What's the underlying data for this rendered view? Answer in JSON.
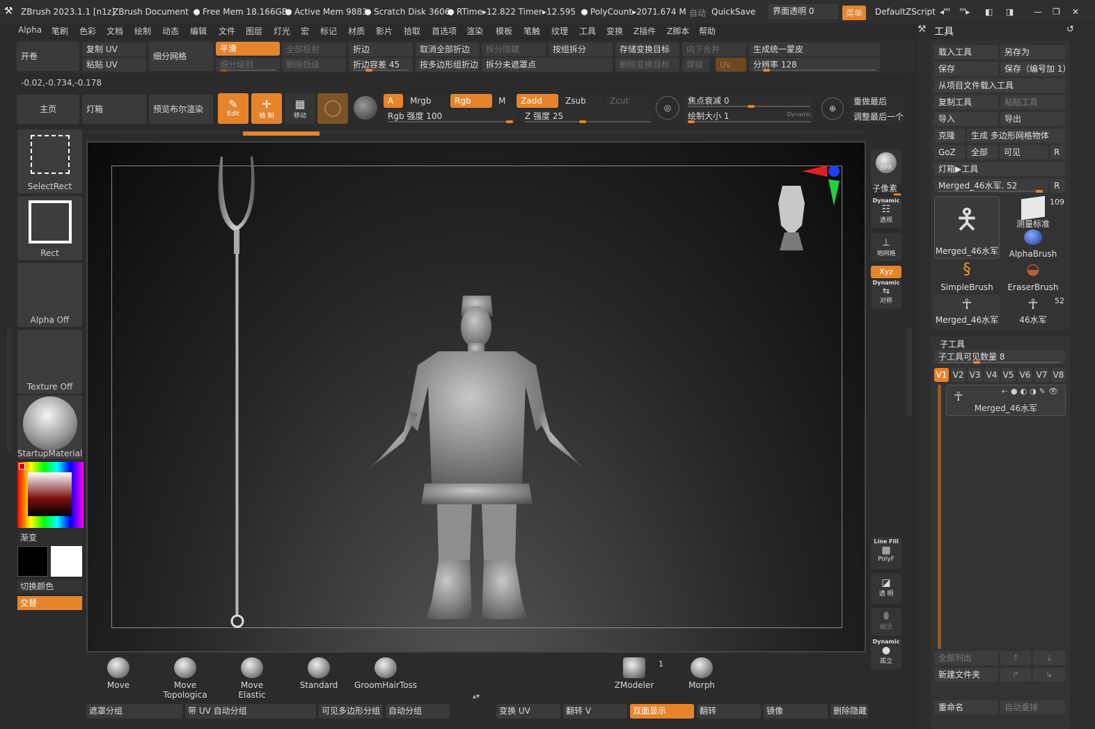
{
  "titlebar": {
    "app": "ZBrush 2023.1.1 [n1z]",
    "doc": "ZBrush Document",
    "free_mem": "Free Mem 18.166GB",
    "active_mem": "Active Mem 9883",
    "scratch": "Scratch Disk 3606",
    "timers": "RTime▸12.822 Timer▸12.595",
    "polycount": "PolyCount▸2071.674 M",
    "auto": "自动",
    "quicksave": "QuickSave",
    "ui_transparency": "界面透明 0",
    "menu": "菜单",
    "zscript": "DefaultZScript"
  },
  "menubar": [
    "Alpha",
    "笔刷",
    "色彩",
    "文档",
    "绘制",
    "动态",
    "编辑",
    "文件",
    "图层",
    "灯光",
    "宏",
    "标记",
    "材质",
    "影片",
    "拾取",
    "首选项",
    "渲染",
    "模板",
    "笔触",
    "纹理",
    "工具",
    "变换",
    "Z插件",
    "Z脚本",
    "帮助"
  ],
  "toolbar1": {
    "roll": "开卷",
    "copy_uv": "复制 UV",
    "paste_uv": "粘贴 UV",
    "subdivide": "细分网格",
    "smooth": "平滑",
    "subdiv_level": "细分级别",
    "project_all": "全部投射",
    "del_lower": "删除低级",
    "crease": "折边",
    "crease_tol": "折边容差 45",
    "uncrease_all": "取消全部折边",
    "crease_pg": "按多边形组折边",
    "split_hidden": "拆分隐藏",
    "split_unmasked": "拆分未遮罩点",
    "groups_split": "按组拆分",
    "store_morph": "存储变换目标",
    "del_morph": "删除变换目标",
    "merge_down": "向下合并",
    "weld": "焊接",
    "uv": "Uv",
    "unify_skin": "生成统一蒙皮",
    "resolution": "分辨率 128",
    "coords": "-0.02,-0.734,-0.178"
  },
  "toolbar2": {
    "home": "主页",
    "lightbox": "灯箱",
    "bpr_preview": "预览布尔渲染",
    "edit": "Edit",
    "draw": "绘 制",
    "move": "移动",
    "a": "A",
    "mrgb": "Mrgb",
    "rgb": "Rgb",
    "m": "M",
    "zadd": "Zadd",
    "zsub": "Zsub",
    "zcut": "Zcut",
    "rgb_intensity": "Rgb 强度 100",
    "z_intensity": "Z 强度 25",
    "focal_shift": "焦点衰减 0",
    "draw_size": "绘制大小 1",
    "dynamic": "Dynamic",
    "redo_last": "重做最后",
    "adjust_last": "调整最后一个"
  },
  "left_shelf": {
    "selectrect": "SelectRect",
    "rect": "Rect",
    "alpha_off": "Alpha Off",
    "texture_off": "Texture Off",
    "material": "StartupMaterial",
    "gradient": "渐变",
    "switch_color": "切换颜色",
    "alternate": "交替"
  },
  "right_shelf": {
    "bpr": "BPR",
    "subpixel": "子像素",
    "dynamic": "Dynamic",
    "persp": "透视",
    "floor": "地网格",
    "xyz": "Xyz",
    "symmetry": "对称",
    "linefill": "Line Fill",
    "polyf": "PolyF",
    "transp": "透 明",
    "ghost": "幽灵",
    "solo": "孤立"
  },
  "brushes": [
    "Move",
    "Move Topologica",
    "Move Elastic",
    "Standard",
    "GroomHairToss",
    "ZModeler",
    "Morph"
  ],
  "zmodeler_count": "1",
  "bottombar": [
    "遮罩分组",
    "带 UV 自动分组",
    "可见多边形分组",
    "自动分组",
    "变换 UV",
    "翻转 V",
    "双面显示",
    "翻转",
    "镜像",
    "删除隐藏"
  ],
  "tool_panel": {
    "title": "工具",
    "load_tool": "载入工具",
    "save_as": "另存为",
    "save": "保存",
    "save_inc": "保存（编号加 1）",
    "load_from_project": "从项目文件载入工具",
    "copy_tool": "复制工具",
    "paste_tool": "粘贴工具",
    "import": "导入",
    "export": "导出",
    "clone": "克隆",
    "make_polymesh": "生成 多边形网格物体",
    "goz": "GoZ",
    "all": "全部",
    "visible": "可见",
    "r": "R",
    "lightbox_tools": "灯箱▶工具",
    "current_tool": "Merged_46水军. 52",
    "thumbs": [
      {
        "label": "Merged_46水军",
        "count": ""
      },
      {
        "label": "测量标准",
        "count": "109"
      },
      {
        "label": "AlphaBrush",
        "count": ""
      },
      {
        "label": "SimpleBrush",
        "count": ""
      },
      {
        "label": "EraserBrush",
        "count": ""
      },
      {
        "label": "Merged_46水军",
        "count": ""
      },
      {
        "label": "46水军",
        "count": "52"
      }
    ]
  },
  "subtool": {
    "title": "子工具",
    "visible_count": "子工具可见数量 8",
    "tabs": [
      "V1",
      "V2",
      "V3",
      "V4",
      "V5",
      "V6",
      "V7",
      "V8"
    ],
    "item": "Merged_46水军",
    "list_all": "全部列出",
    "new_folder": "新建文件夹",
    "rename": "重命名",
    "auto_reorder": "自动重排"
  }
}
